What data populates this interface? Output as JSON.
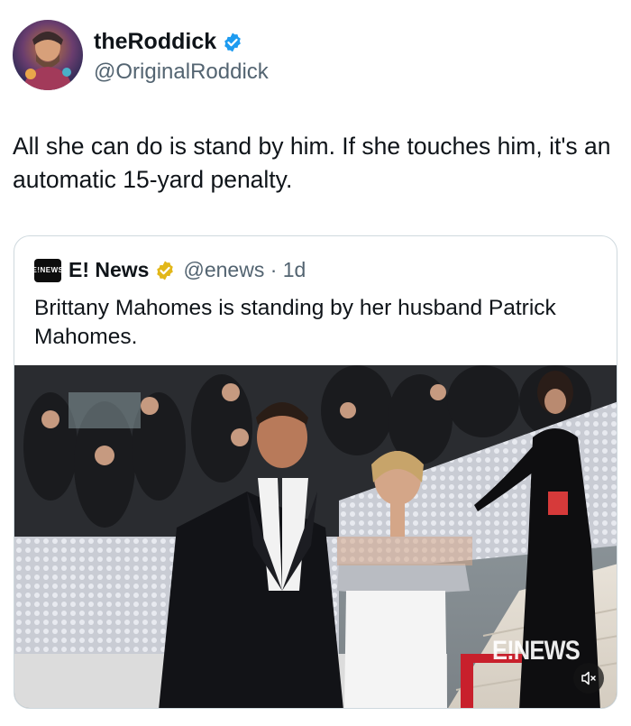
{
  "author": {
    "display_name": "theRoddick",
    "handle": "@OriginalRoddick",
    "verified_icon": "verified-badge-icon",
    "badge_color": "#1d9bf0"
  },
  "tweet": {
    "text": "All she can do is stand by him. If she touches him, it's an automatic 15-yard penalty."
  },
  "quoted_tweet": {
    "logo_label": "E!NEWS",
    "display_name": "E! News",
    "handle_time": "@enews · 1d",
    "verified_icon": "gold-verified-badge-icon",
    "badge_color": "#e2b719",
    "text": "Brittany Mahomes is standing by her husband Patrick Mahomes.",
    "media": {
      "watermark": "E!NEWS",
      "mute_icon": "speaker-muted-icon"
    }
  }
}
